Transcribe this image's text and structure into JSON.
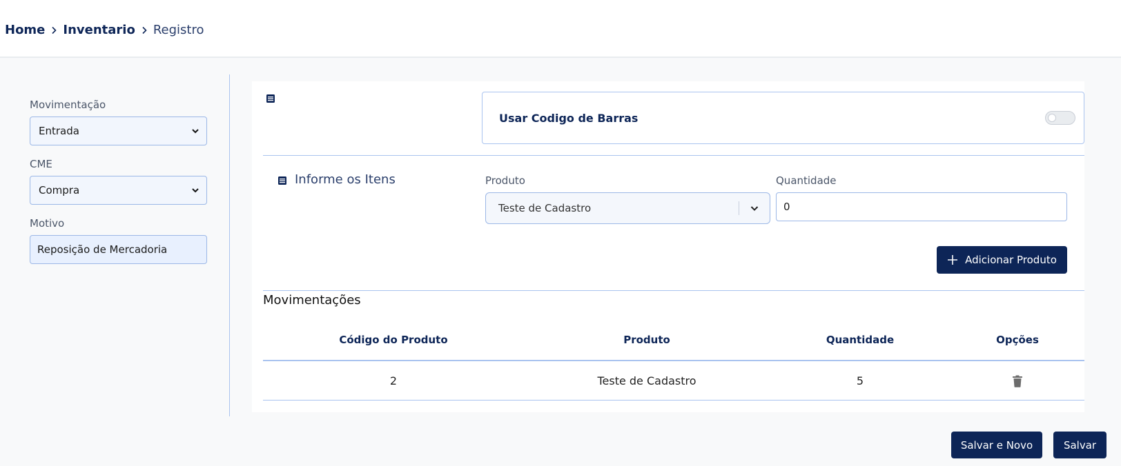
{
  "breadcrumb": {
    "home": "Home",
    "section": "Inventario",
    "current": "Registro"
  },
  "form": {
    "movimentacao": {
      "label": "Movimentação",
      "value": "Entrada"
    },
    "cme": {
      "label": "CME",
      "value": "Compra"
    },
    "motivo": {
      "label": "Motivo",
      "value": "Reposição de Mercadoria"
    }
  },
  "barcode": {
    "label": "Usar Codigo de Barras",
    "enabled": false
  },
  "items": {
    "title": "Informe os Itens",
    "produto_label": "Produto",
    "produto_value": "Teste de Cadastro",
    "quantidade_label": "Quantidade",
    "quantidade_value": "0",
    "add_button": "Adicionar Produto"
  },
  "movimentacoes": {
    "title": "Movimentações",
    "columns": [
      "Código do Produto",
      "Produto",
      "Quantidade",
      "Opções"
    ],
    "rows": [
      {
        "codigo": "2",
        "produto": "Teste de Cadastro",
        "quantidade": "5"
      }
    ]
  },
  "actions": {
    "save_new": "Salvar e Novo",
    "save": "Salvar"
  },
  "colors": {
    "primary": "#0d2557",
    "border": "#a9c3ef",
    "input_bg": "#f2f6fd"
  }
}
